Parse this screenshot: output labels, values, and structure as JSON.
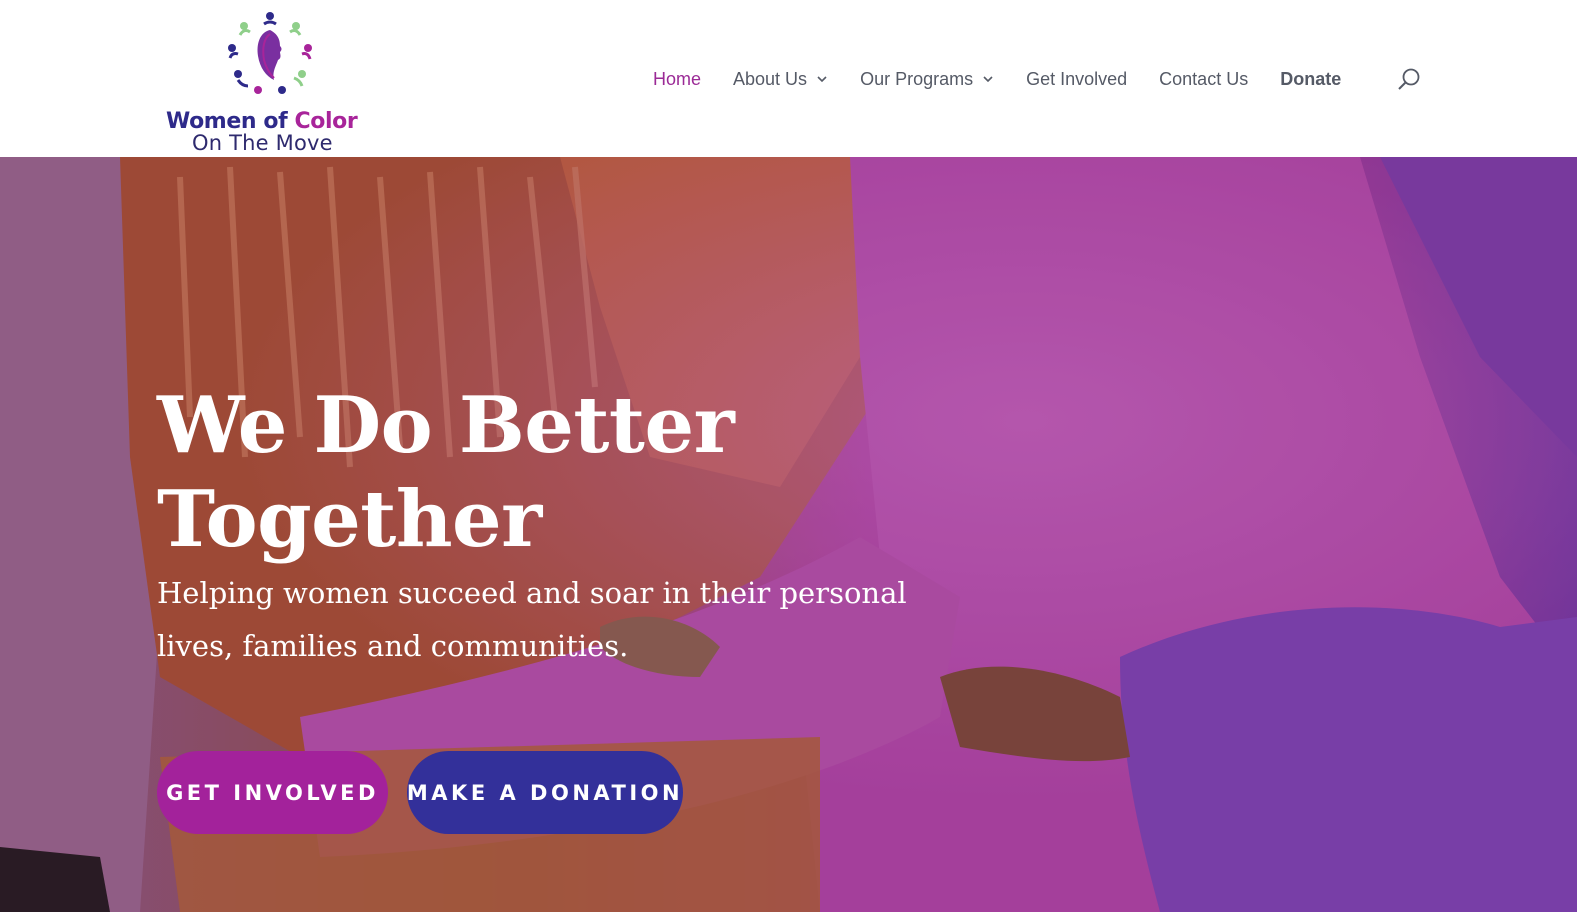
{
  "brand": {
    "name_part1": "Women of ",
    "name_part2": "Color",
    "tagline": "On The Move",
    "colors": {
      "navy": "#2e2a8a",
      "magenta": "#a8249a",
      "green": "#8fcf8a"
    }
  },
  "nav": {
    "items": [
      {
        "label": "Home",
        "active": true,
        "dropdown": false
      },
      {
        "label": "About Us",
        "active": false,
        "dropdown": true
      },
      {
        "label": "Our Programs",
        "active": false,
        "dropdown": true
      },
      {
        "label": "Get Involved",
        "active": false,
        "dropdown": false
      },
      {
        "label": "Contact Us",
        "active": false,
        "dropdown": false
      },
      {
        "label": "Donate",
        "active": false,
        "dropdown": false,
        "bold": true
      }
    ],
    "search_icon": "search-icon"
  },
  "hero": {
    "title_line1": "We Do Better",
    "title_line2": "Together",
    "subtitle_line1": "Helping women succeed and soar in their personal",
    "subtitle_line2": "lives, families and communities.",
    "primary_button": "GET INVOLVED",
    "secondary_button": "MAKE A DONATION",
    "colors": {
      "primary_button": "#a3229b",
      "secondary_button": "#33309a"
    }
  }
}
